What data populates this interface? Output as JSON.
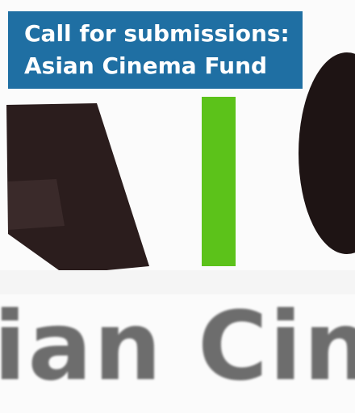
{
  "headline": {
    "line1": "Call for submissions:",
    "line2": "Asian Cinema Fund"
  },
  "background": {
    "logo_text": "ian Cin",
    "colors": {
      "title_bg": "#1f6fa3",
      "dark_shape": "#2a1a1a",
      "green_bar": "#5cc21a",
      "text_gray": "#555555"
    }
  }
}
